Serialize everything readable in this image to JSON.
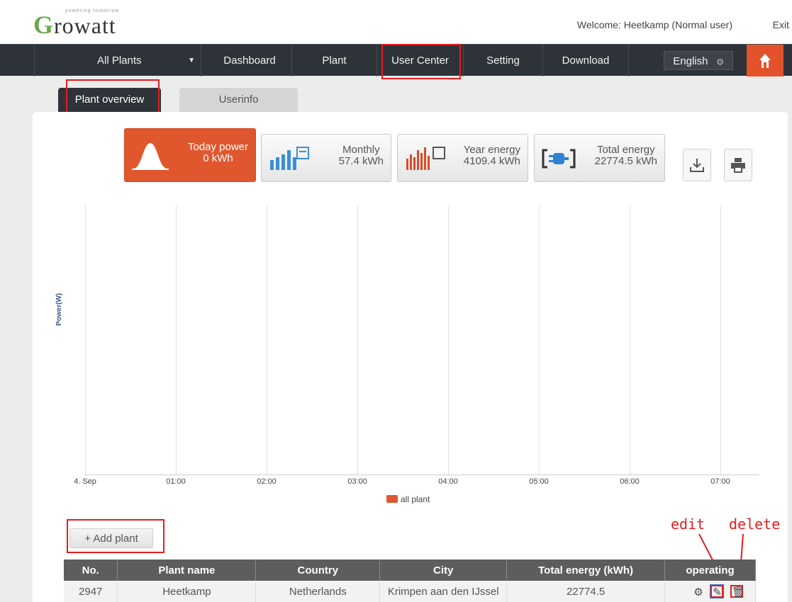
{
  "header": {
    "logo_text": "rowatt",
    "logo_letter": "G",
    "tagline": "powering tomorrow",
    "welcome": "Welcome:  Heetkamp (Normal user)",
    "exit": "Exit"
  },
  "nav": {
    "plants_select": "All Plants",
    "items": [
      "Dashboard",
      "Plant",
      "User Center",
      "Setting",
      "Download"
    ],
    "language": "English"
  },
  "tabs": [
    "Plant overview",
    "Userinfo"
  ],
  "stats": [
    {
      "label": "Today power",
      "value": "0 kWh"
    },
    {
      "label": "Monthly",
      "value": "57.4 kWh"
    },
    {
      "label": "Year energy",
      "value": "4109.4 kWh"
    },
    {
      "label": "Total energy",
      "value": "22774.5 kWh"
    }
  ],
  "chart_data": {
    "type": "line",
    "ylabel": "Power(W)",
    "x": [
      "4. Sep",
      "01:00",
      "02:00",
      "03:00",
      "04:00",
      "05:00",
      "06:00",
      "07:00"
    ],
    "series": [
      {
        "name": "all plant",
        "values": []
      }
    ],
    "color": "#e0572e",
    "grid": true,
    "legend": "bottom"
  },
  "add_plant": "+ Add plant",
  "annotations": {
    "edit": "edit",
    "delete": "delete"
  },
  "table": {
    "headers": [
      "No.",
      "Plant name",
      "Country",
      "City",
      "Total energy  (kWh)",
      "operating"
    ],
    "rows": [
      [
        "2947",
        "Heetkamp",
        "Netherlands",
        "Krimpen aan den IJssel",
        "22774.5"
      ]
    ]
  }
}
